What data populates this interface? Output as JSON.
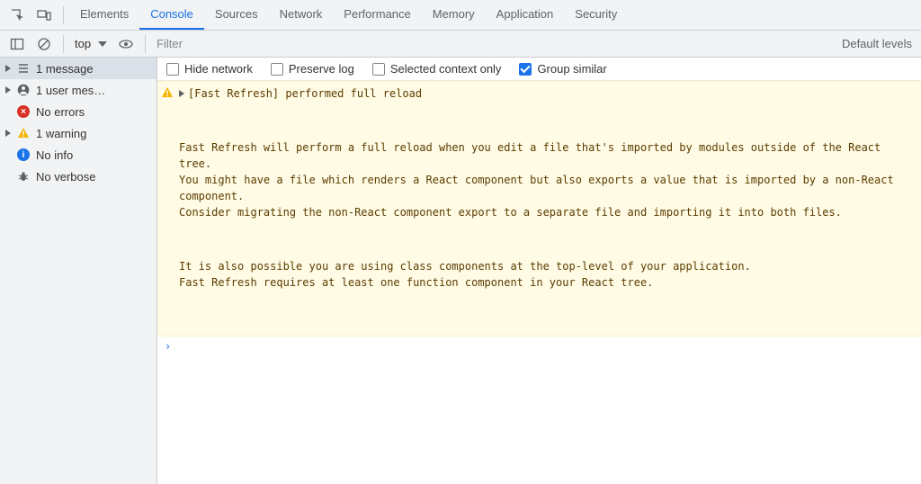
{
  "tabs": {
    "elements": "Elements",
    "console": "Console",
    "sources": "Sources",
    "network": "Network",
    "performance": "Performance",
    "memory": "Memory",
    "application": "Application",
    "security": "Security"
  },
  "toolbar": {
    "context": "top",
    "filter_placeholder": "Filter",
    "levels": "Default levels"
  },
  "options": {
    "hide_network": "Hide network",
    "preserve_log": "Preserve log",
    "selected_context_only": "Selected context only",
    "group_similar": "Group similar"
  },
  "sidebar": {
    "messages": "1 message",
    "user_messages": "1 user mes…",
    "no_errors": "No errors",
    "warnings": "1 warning",
    "no_info": "No info",
    "no_verbose": "No verbose"
  },
  "log": {
    "summary": "[Fast Refresh] performed full reload",
    "para1": "Fast Refresh will perform a full reload when you edit a file that's imported by modules outside of the React tree.\nYou might have a file which renders a React component but also exports a value that is imported by a non-React component.\nConsider migrating the non-React component export to a separate file and importing it into both files.",
    "para2": "It is also possible you are using class components at the top-level of your application.\nFast Refresh requires at least one function component in your React tree."
  }
}
